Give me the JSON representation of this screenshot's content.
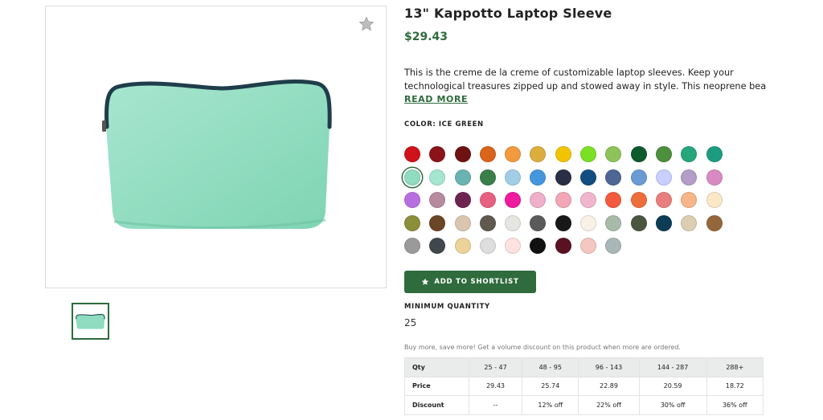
{
  "product": {
    "title": "13\" Kappotto Laptop Sleeve",
    "price": "$29.43",
    "description_line1": "This is the creme de la creme of customizable laptop sleeves. Keep your",
    "description_line2": "technological treasures zipped up and stowed away in style. This neoprene beauty i...",
    "read_more": "READ MORE",
    "color_label": "COLOR: ICE GREEN",
    "image_icon": "laptop-sleeve-image"
  },
  "colors": {
    "accent": "#2f6b3c",
    "product_fill": "#8fdcc0",
    "zipper": "#1f3d4a"
  },
  "swatches": [
    [
      "#d0121b",
      "#8a1419",
      "#6e1212",
      "#d9641b",
      "#f3993e",
      "#dcae3e",
      "#f2c400",
      "#7be024",
      "#8ec35a",
      "#0d5a2c",
      "#4c8f3c",
      "#27a67c",
      "#1e9c82"
    ],
    [
      "#8fdcc0",
      "#a4e6cf",
      "#6ab3b3",
      "#3a7f4a",
      "#a1cde6",
      "#4596de",
      "#2b2f45",
      "#124d82",
      "#4e6694",
      "#6a9bd4",
      "#c9cfff",
      "#b49ec9",
      "#d98ac2"
    ],
    [
      "#b86ee0",
      "#b88aa0",
      "#6e2450",
      "#e8607f",
      "#f01aa0",
      "#efaec9",
      "#f2a6b8",
      "#f1b6cd",
      "#f45a3e",
      "#ee6d3a",
      "#e97e7e",
      "#f6b689",
      "#fbe6c6"
    ],
    [
      "#8b8f3a",
      "#6a4526",
      "#dac6b0",
      "#5f594f",
      "#e6e6e1",
      "#5a5a5a",
      "#181818",
      "#f8f1e6",
      "#a8bba8",
      "#4a5640",
      "#0d3d56",
      "#dccdb3",
      "#95663c"
    ],
    [
      "#9a9a9a",
      "#41474c",
      "#ebd39a",
      "#dedede",
      "#fde2e0",
      "#111111",
      "#5a1122",
      "#f4c8c0",
      "#a8b8b6"
    ]
  ],
  "selected_swatch": "#8fdcc0",
  "shortlist": {
    "label": "ADD TO SHORTLIST",
    "icon": "star-icon"
  },
  "min_quantity": {
    "label": "MINIMUM QUANTITY",
    "value": "25"
  },
  "volume_note": "Buy more, save more! Get a volume discount on this product when more are ordered.",
  "pricing_table": {
    "headers": [
      "Qty",
      "25 - 47",
      "48 - 95",
      "96 - 143",
      "144 - 287",
      "288+"
    ],
    "price_row": [
      "Price",
      "29.43",
      "25.74",
      "22.89",
      "20.59",
      "18.72"
    ],
    "discount_row": [
      "Discount",
      "--",
      "12% off",
      "22% off",
      "30% off",
      "36% off"
    ]
  },
  "favorite_icon": "star-icon"
}
